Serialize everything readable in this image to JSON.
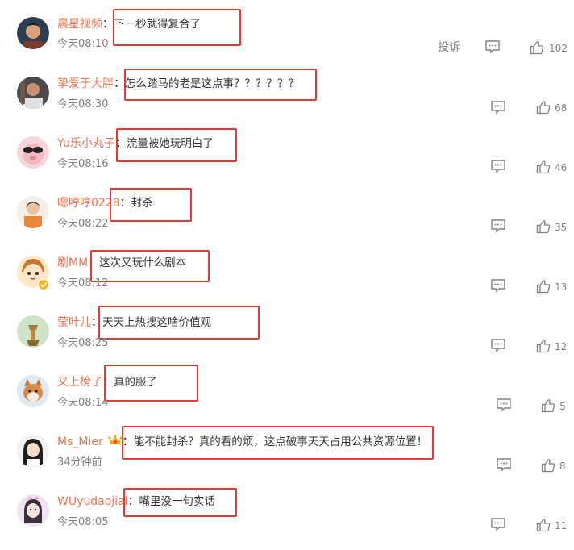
{
  "report_label": "投诉",
  "colon": "：",
  "comments": [
    {
      "user": "晨星视频",
      "text": "下一秒就得复合了",
      "time": "今天08:10",
      "likes": "102"
    },
    {
      "user": "挚爱于大胖",
      "text": "怎么踏马的老是这点事？？？？？？",
      "time": "今天08:30",
      "likes": "68"
    },
    {
      "user": "Yu乐小丸子",
      "text": "流量被她玩明白了",
      "time": "今天08:16",
      "likes": "46"
    },
    {
      "user": "嗯哼哼0228",
      "text": "封杀",
      "time": "今天08:22",
      "likes": "35"
    },
    {
      "user": "剧MM",
      "text": "这次又玩什么剧本",
      "time": "今天08:12",
      "likes": "13"
    },
    {
      "user": "莹叶儿",
      "text": "天天上热搜这啥价值观",
      "time": "今天08:25",
      "likes": "12"
    },
    {
      "user": "又上榜了",
      "text": "真的服了",
      "time": "今天08:14",
      "likes": "5"
    },
    {
      "user": "Ms_Mier",
      "text": "能不能封杀？真的看的烦，这点破事天天占用公共资源位置！",
      "time": "34分钟前",
      "likes": "8"
    },
    {
      "user": "WUyudaojial",
      "text": "嘴里没一句实话",
      "time": "今天08:05",
      "likes": "11"
    }
  ],
  "colors": {
    "username": "#eb7350",
    "highlight": "#e53935",
    "meta": "#808080",
    "text": "#333333"
  },
  "icons": {
    "reply": "comment-icon",
    "like": "thumbs-up-icon",
    "badge": "crown-badge-icon",
    "verified": "verified-badge-icon"
  }
}
